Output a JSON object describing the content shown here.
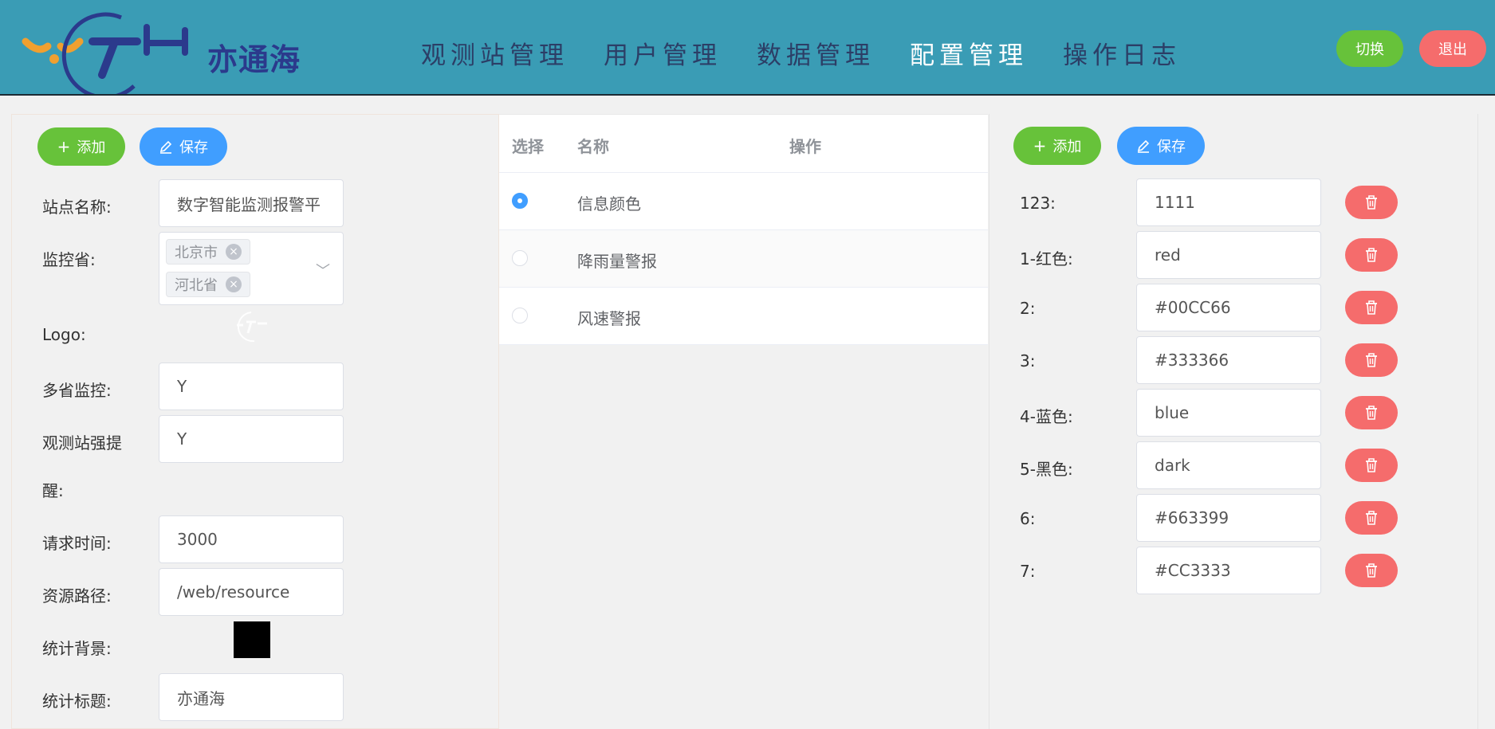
{
  "header": {
    "logo_text": "亦通海",
    "nav": [
      "观测站管理",
      "用户管理",
      "数据管理",
      "配置管理",
      "操作日志"
    ],
    "active_nav": 3,
    "switch_label": "切换",
    "logout_label": "退出",
    "colors": {
      "bg": "#3a9cb5",
      "nav_text": "#2c3e66",
      "nav_active": "#ffffff"
    }
  },
  "left_panel": {
    "add_label": "添加",
    "save_label": "保存",
    "fields": {
      "site_name_label": "站点名称:",
      "site_name_value": "数字智能监测报警平",
      "province_label": "监控省:",
      "province_tags": [
        "北京市",
        "河北省"
      ],
      "logo_label": "Logo:",
      "multi_province_label": "多省监控:",
      "multi_province_value": "Y",
      "station_alert_label_1": "观测站强提",
      "station_alert_label_2": "醒:",
      "station_alert_value": "Y",
      "request_time_label": "请求时间:",
      "request_time_value": "3000",
      "resource_path_label": "资源路径:",
      "resource_path_value": "/web/resource",
      "stat_bg_label": "统计背景:",
      "stat_title_label": "统计标题:",
      "stat_title_value": "亦通海"
    }
  },
  "middle_table": {
    "headers": {
      "select": "选择",
      "name": "名称",
      "action": "操作"
    },
    "rows": [
      {
        "name": "信息颜色",
        "selected": true
      },
      {
        "name": "降雨量警报",
        "selected": false
      },
      {
        "name": "风速警报",
        "selected": false
      }
    ]
  },
  "right_panel": {
    "add_label": "添加",
    "save_label": "保存",
    "items": [
      {
        "key": "123:",
        "value": "1111"
      },
      {
        "key": "1-红色:",
        "value": "red"
      },
      {
        "key": "2:",
        "value": "#00CC66"
      },
      {
        "key": "3:",
        "value": "#333366"
      },
      {
        "key": "4-蓝色:",
        "value": "blue"
      },
      {
        "key": "5-黑色:",
        "value": "dark"
      },
      {
        "key": "6:",
        "value": "#663399"
      },
      {
        "key": "7:",
        "value": "#CC3333"
      }
    ]
  }
}
